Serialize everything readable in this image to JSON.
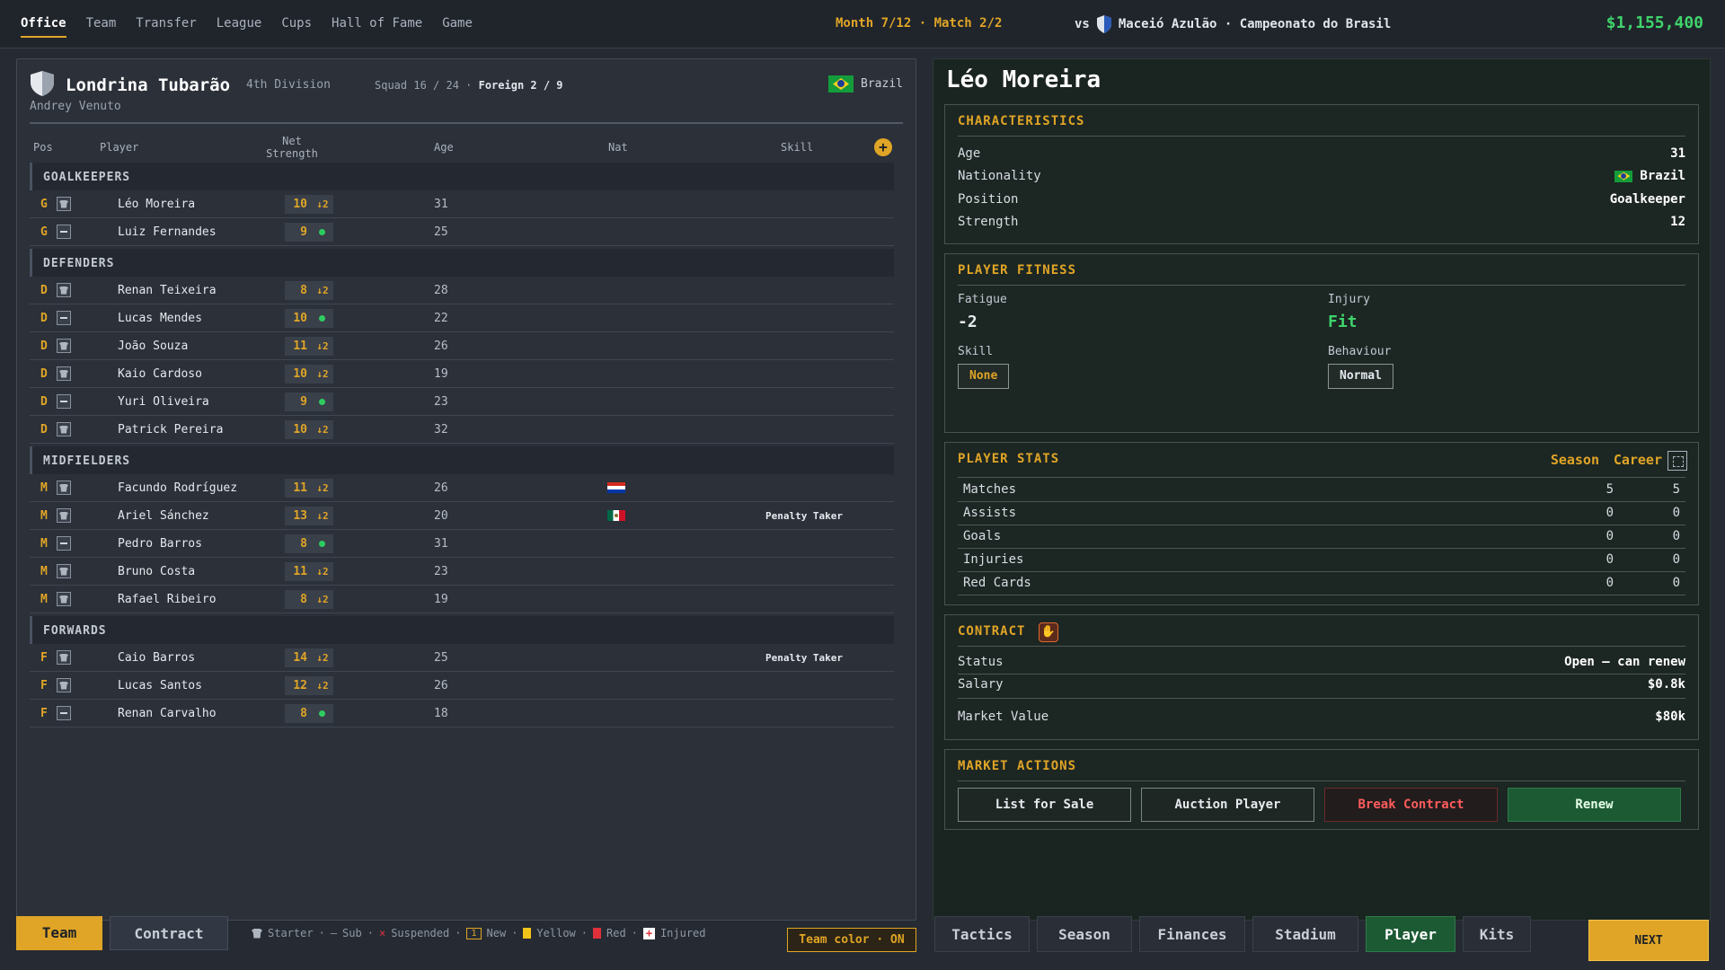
{
  "topnav": {
    "items": [
      "Office",
      "Team",
      "Transfer",
      "League",
      "Cups",
      "Hall of Fame",
      "Game"
    ],
    "active": "Office"
  },
  "match_info": "Month 7/12 · Match 2/2",
  "opponent": {
    "prefix": "vs",
    "name": "Maceió Azulão · Campeonato do Brasil"
  },
  "money": "$1,155,400",
  "team": {
    "name": "Londrina Tubarão",
    "division": "4th Division",
    "squad_label": "Squad 16 / 24",
    "foreign_label": "Foreign 2 / 9",
    "manager": "Andrey Venuto",
    "country": "Brazil"
  },
  "table_head": {
    "pos": "Pos",
    "player": "Player",
    "net": "Net",
    "strength": "Strength",
    "age": "Age",
    "nat": "Nat",
    "skill": "Skill"
  },
  "sections": {
    "gk": "GOALKEEPERS",
    "def": "DEFENDERS",
    "mid": "MIDFIELDERS",
    "fwd": "FORWARDS"
  },
  "players": [
    {
      "pos": "G",
      "status": "starter",
      "name": "Léo Moreira",
      "strength": "10",
      "delta": "↓2",
      "age": "31",
      "nat": "",
      "skill": ""
    },
    {
      "pos": "G",
      "status": "sub",
      "name": "Luiz Fernandes",
      "strength": "9",
      "delta": "",
      "age": "25",
      "nat": "",
      "skill": ""
    },
    {
      "pos": "D",
      "status": "starter",
      "name": "Renan Teixeira",
      "strength": "8",
      "delta": "↓2",
      "age": "28",
      "nat": "",
      "skill": ""
    },
    {
      "pos": "D",
      "status": "sub",
      "name": "Lucas Mendes",
      "strength": "10",
      "delta": "",
      "age": "22",
      "nat": "",
      "skill": ""
    },
    {
      "pos": "D",
      "status": "starter",
      "name": "João Souza",
      "strength": "11",
      "delta": "↓2",
      "age": "26",
      "nat": "",
      "skill": ""
    },
    {
      "pos": "D",
      "status": "starter",
      "name": "Kaio Cardoso",
      "strength": "10",
      "delta": "↓2",
      "age": "19",
      "nat": "",
      "skill": ""
    },
    {
      "pos": "D",
      "status": "sub",
      "name": "Yuri Oliveira",
      "strength": "9",
      "delta": "",
      "age": "23",
      "nat": "",
      "skill": ""
    },
    {
      "pos": "D",
      "status": "starter",
      "name": "Patrick Pereira",
      "strength": "10",
      "delta": "↓2",
      "age": "32",
      "nat": "",
      "skill": ""
    },
    {
      "pos": "M",
      "status": "starter",
      "name": "Facundo Rodríguez",
      "strength": "11",
      "delta": "↓2",
      "age": "26",
      "nat": "paraguay-flag",
      "skill": ""
    },
    {
      "pos": "M",
      "status": "starter",
      "name": "Ariel Sánchez",
      "strength": "13",
      "delta": "↓2",
      "age": "20",
      "nat": "mexico-flag",
      "skill": "Penalty Taker"
    },
    {
      "pos": "M",
      "status": "sub",
      "name": "Pedro Barros",
      "strength": "8",
      "delta": "",
      "age": "31",
      "nat": "",
      "skill": ""
    },
    {
      "pos": "M",
      "status": "starter",
      "name": "Bruno Costa",
      "strength": "11",
      "delta": "↓2",
      "age": "23",
      "nat": "",
      "skill": ""
    },
    {
      "pos": "M",
      "status": "starter",
      "name": "Rafael Ribeiro",
      "strength": "8",
      "delta": "↓2",
      "age": "19",
      "nat": "",
      "skill": ""
    },
    {
      "pos": "F",
      "status": "starter",
      "name": "Caio Barros",
      "strength": "14",
      "delta": "↓2",
      "age": "25",
      "nat": "",
      "skill": "Penalty Taker"
    },
    {
      "pos": "F",
      "status": "starter",
      "name": "Lucas Santos",
      "strength": "12",
      "delta": "↓2",
      "age": "26",
      "nat": "",
      "skill": ""
    },
    {
      "pos": "F",
      "status": "sub",
      "name": "Renan Carvalho",
      "strength": "8",
      "delta": "",
      "age": "18",
      "nat": "",
      "skill": ""
    }
  ],
  "bottom_left": {
    "tab_team": "Team",
    "tab_contract": "Contract",
    "legend": {
      "starter": "Starter",
      "sep": "·",
      "sub_mark": "–",
      "sub": "Sub",
      "susp_mark": "×",
      "suspended": "Suspended",
      "new_badge": "1",
      "new": "New",
      "yellow": "Yellow",
      "red": "Red",
      "injured_mark": "+",
      "injured": "Injured"
    },
    "team_color": "Team color · ON"
  },
  "player": {
    "name": "Léo Moreira",
    "characteristics": {
      "title": "CHARACTERISTICS",
      "age_label": "Age",
      "age": "31",
      "nat_label": "Nationality",
      "nat": "Brazil",
      "pos_label": "Position",
      "pos": "Goalkeeper",
      "str_label": "Strength",
      "str": "12"
    },
    "fitness": {
      "title": "PLAYER FITNESS",
      "fatigue_label": "Fatigue",
      "fatigue": "-2",
      "injury_label": "Injury",
      "injury": "Fit",
      "skill_label": "Skill",
      "skill": "None",
      "behaviour_label": "Behaviour",
      "behaviour": "Normal"
    },
    "stats": {
      "title": "PLAYER STATS",
      "season": "Season",
      "career": "Career",
      "rows": [
        {
          "label": "Matches",
          "season": "5",
          "career": "5"
        },
        {
          "label": "Assists",
          "season": "0",
          "career": "0"
        },
        {
          "label": "Goals",
          "season": "0",
          "career": "0"
        },
        {
          "label": "Injuries",
          "season": "0",
          "career": "0"
        },
        {
          "label": "Red Cards",
          "season": "0",
          "career": "0"
        }
      ]
    },
    "contract": {
      "title": "CONTRACT",
      "status_label": "Status",
      "status": "Open — can renew",
      "salary_label": "Salary",
      "salary": "$0.8k",
      "value_label": "Market Value",
      "value": "$80k"
    },
    "market": {
      "title": "MARKET ACTIONS",
      "list": "List for Sale",
      "auction": "Auction Player",
      "break": "Break Contract",
      "renew": "Renew"
    }
  },
  "bottom_right": {
    "tabs": [
      "Tactics",
      "Season",
      "Finances",
      "Stadium",
      "Player",
      "Kits"
    ],
    "active": "Player",
    "next": "NEXT"
  },
  "colors": {
    "accent": "#e0a526",
    "money": "#3fd36b",
    "fit": "#3fd36b",
    "danger": "#ff5c5c",
    "renew_bg": "#1c5a34"
  }
}
